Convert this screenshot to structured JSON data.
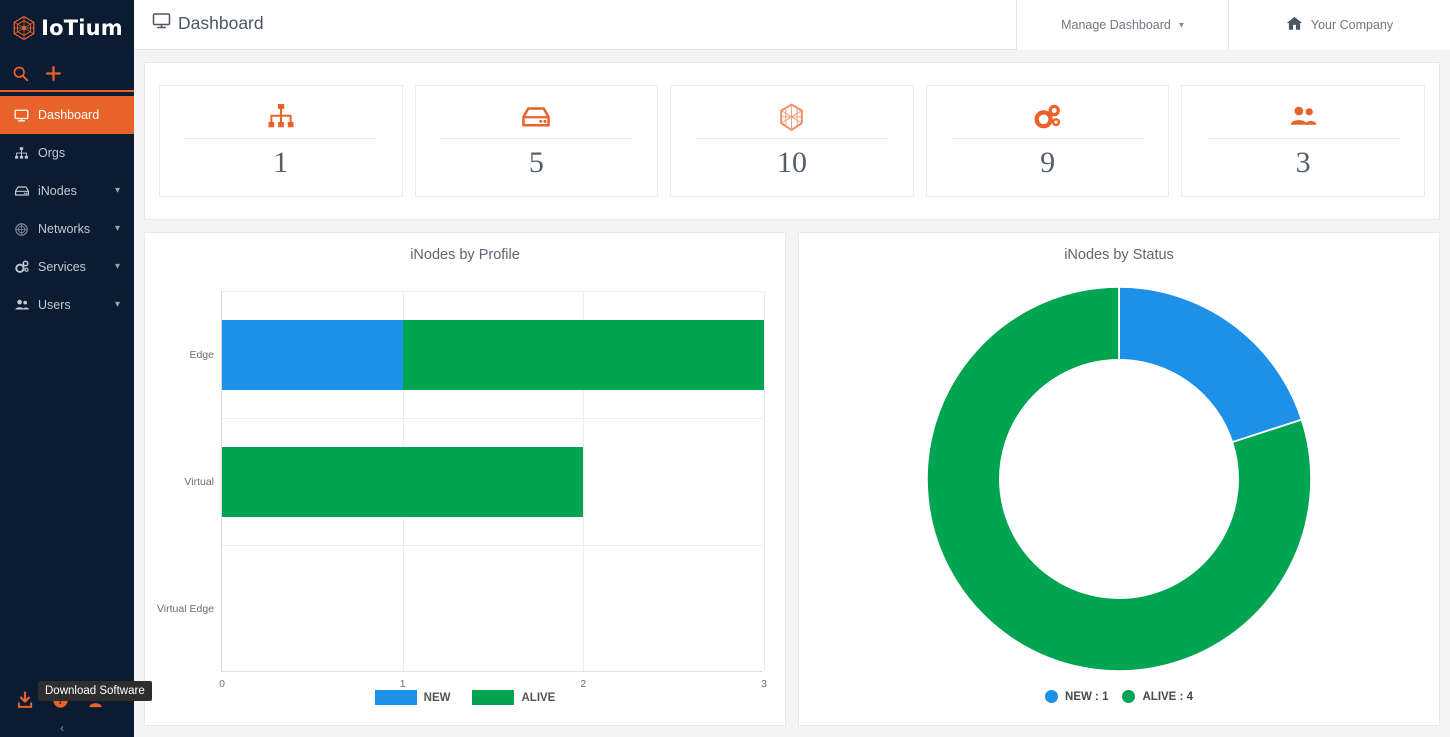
{
  "brand": {
    "name": "IoTium",
    "logo_icon": "iotium-hex-logo"
  },
  "sidebar": {
    "quick_actions": [
      {
        "name": "search-icon",
        "label": "Search"
      },
      {
        "name": "add-icon",
        "label": "Add"
      }
    ],
    "items": [
      {
        "label": "Dashboard",
        "icon": "monitor-icon",
        "active": true,
        "caret": false
      },
      {
        "label": "Orgs",
        "icon": "sitemap-icon",
        "active": false,
        "caret": false
      },
      {
        "label": "iNodes",
        "icon": "server-icon",
        "active": false,
        "caret": true
      },
      {
        "label": "Networks",
        "icon": "network-icon",
        "active": false,
        "caret": true
      },
      {
        "label": "Services",
        "icon": "gears-icon",
        "active": false,
        "caret": true
      },
      {
        "label": "Users",
        "icon": "users-icon",
        "active": false,
        "caret": true
      }
    ],
    "bottom_icons": [
      {
        "name": "download-icon",
        "label": "Download Software"
      },
      {
        "name": "help-icon",
        "label": "Help"
      },
      {
        "name": "profile-icon",
        "label": "Profile"
      }
    ],
    "tooltip": "Download Software",
    "collapse_glyph": "‹"
  },
  "header": {
    "title": "Dashboard",
    "title_icon": "monitor-icon",
    "manage_dashboard": {
      "label": "Manage Dashboard",
      "caret_icon": "chevron-down-icon"
    },
    "company": {
      "label": "Your Company",
      "icon": "home-icon"
    }
  },
  "stats": [
    {
      "icon": "sitemap-icon",
      "value": "1",
      "name": "orgs"
    },
    {
      "icon": "server-icon",
      "value": "5",
      "name": "inodes"
    },
    {
      "icon": "network-icon",
      "value": "10",
      "name": "networks"
    },
    {
      "icon": "gears-icon",
      "value": "9",
      "name": "services"
    },
    {
      "icon": "users-icon",
      "value": "3",
      "name": "users"
    }
  ],
  "colors": {
    "accent": "#e8622a",
    "sidebar_bg": "#0b1c32",
    "new": "#1d90e8",
    "alive": "#00a451",
    "page_bg": "#f4f4f4"
  },
  "chart_data": [
    {
      "type": "bar",
      "orientation": "horizontal",
      "stacked": true,
      "title": "iNodes by Profile",
      "categories": [
        "Edge",
        "Virtual",
        "Virtual Edge"
      ],
      "series": [
        {
          "name": "NEW",
          "color": "#1d90e8",
          "values": [
            1,
            0,
            0
          ]
        },
        {
          "name": "ALIVE",
          "color": "#00a451",
          "values": [
            2,
            2,
            0
          ]
        }
      ],
      "xlabel": "",
      "ylabel": "",
      "xlim": [
        0,
        3
      ],
      "xticks": [
        "0",
        "1",
        "2",
        "3"
      ],
      "grid": true,
      "legend_position": "bottom"
    },
    {
      "type": "pie",
      "variant": "donut",
      "title": "iNodes by Status",
      "labels": [
        "NEW",
        "ALIVE"
      ],
      "values": [
        1,
        4
      ],
      "colors": [
        "#1d90e8",
        "#00a451"
      ],
      "legend_entries": [
        "NEW : 1",
        "ALIVE : 4"
      ],
      "legend_position": "bottom",
      "start_angle_deg": 0,
      "inner_radius_ratio": 0.62
    }
  ]
}
